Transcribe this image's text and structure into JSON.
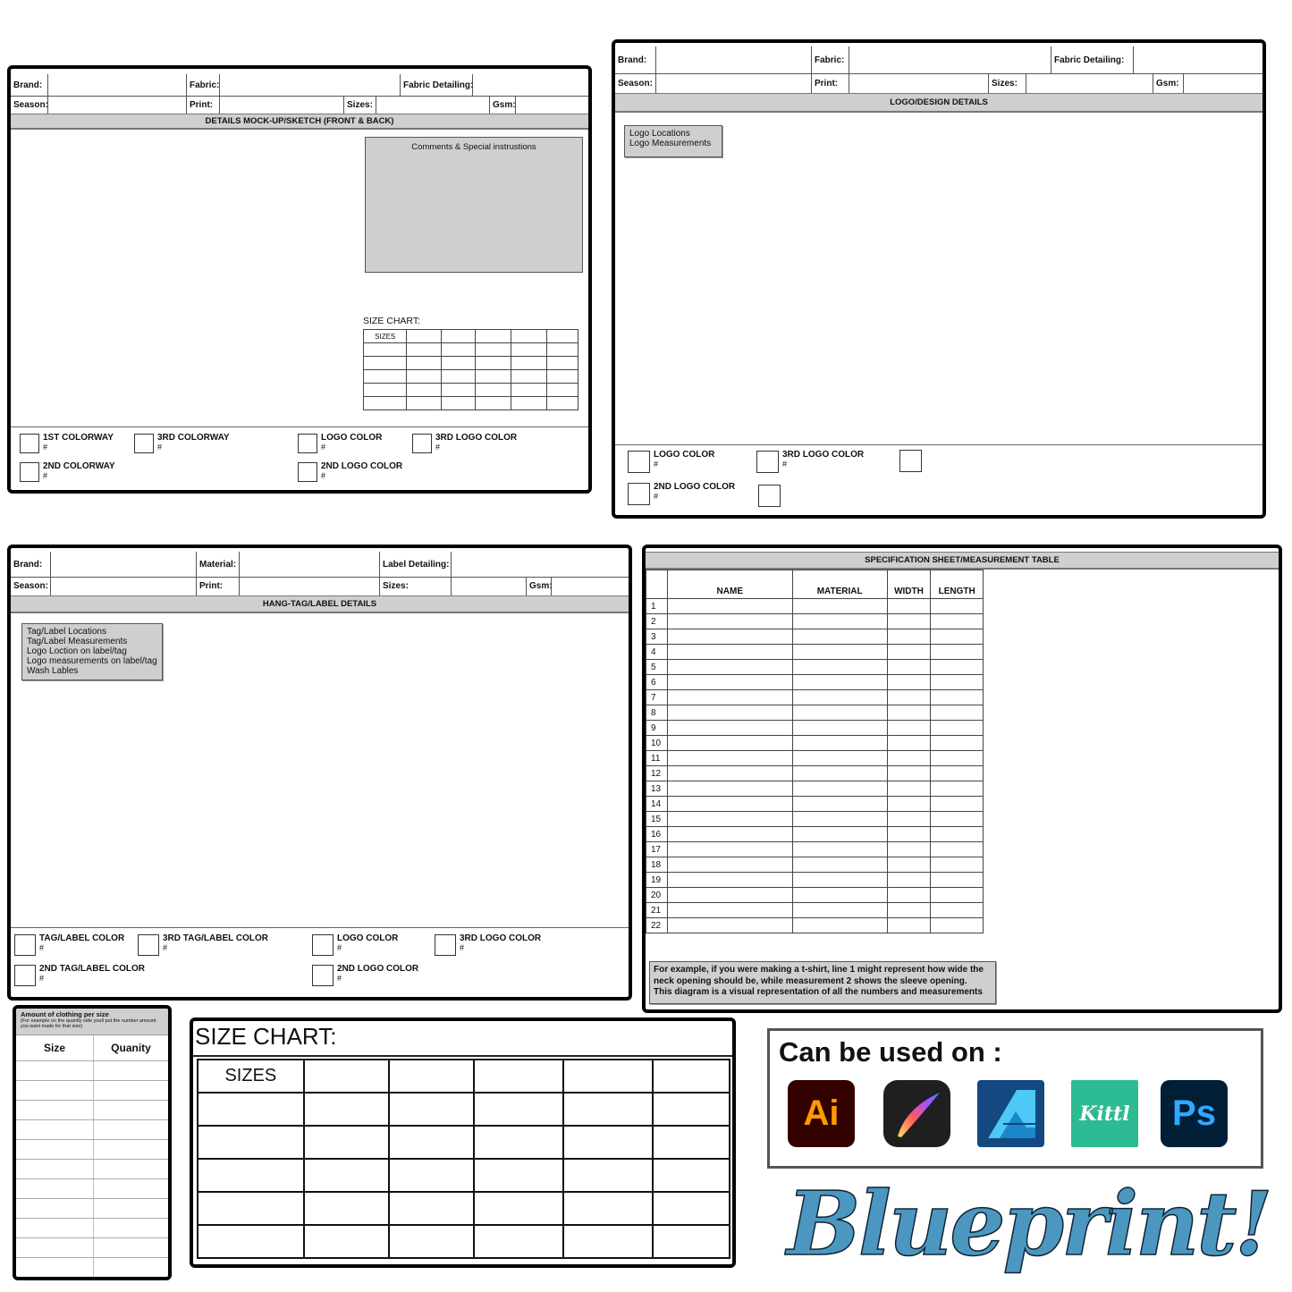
{
  "form1": {
    "row1": [
      "Brand:",
      "Fabric:",
      "Fabric Detailing:"
    ],
    "row2": [
      "Season:",
      "Print:",
      "Sizes:",
      "Gsm:"
    ],
    "band": "DETAILS MOCK-UP/SKETCH (FRONT & BACK)",
    "comments": "Comments & Special instrustions",
    "size_chart_label": "SIZE CHART:",
    "size_chart_header": "SIZES",
    "swatches": [
      {
        "label": "1ST COLORWAY",
        "hash": "#"
      },
      {
        "label": "3RD COLORWAY",
        "hash": "#"
      },
      {
        "label": "LOGO COLOR",
        "hash": "#"
      },
      {
        "label": "3RD LOGO COLOR",
        "hash": "#"
      },
      {
        "label": "2ND COLORWAY",
        "hash": "#"
      },
      {
        "label": "2ND LOGO COLOR",
        "hash": "#"
      }
    ]
  },
  "form2": {
    "row1": [
      "Brand:",
      "Fabric:",
      "Fabric Detailing:"
    ],
    "row2": [
      "Season:",
      "Print:",
      "Sizes:",
      "Gsm:"
    ],
    "band": "LOGO/DESIGN DETAILS",
    "notes": [
      "Logo Locations",
      "Logo Measurements"
    ],
    "swatches": [
      {
        "label": "LOGO COLOR",
        "hash": "#"
      },
      {
        "label": "3RD LOGO COLOR",
        "hash": "#"
      },
      {
        "label": "2ND LOGO COLOR",
        "hash": "#"
      }
    ]
  },
  "form3": {
    "row1": [
      "Brand:",
      "Material:",
      "Label Detailing:"
    ],
    "row2": [
      "Season:",
      "Print:",
      "Sizes:",
      "Gsm:"
    ],
    "band": "HANG-TAG/LABEL DETAILS",
    "notes": [
      "Tag/Label Locations",
      "Tag/Label Measurements",
      "Logo Loction on label/tag",
      "Logo measurements on label/tag",
      "Wash Lables"
    ],
    "swatches": [
      {
        "label": "TAG/LABEL COLOR",
        "hash": "#"
      },
      {
        "label": "3RD TAG/LABEL COLOR",
        "hash": "#"
      },
      {
        "label": "LOGO COLOR",
        "hash": "#"
      },
      {
        "label": "3RD LOGO COLOR",
        "hash": "#"
      },
      {
        "label": "2ND TAG/LABEL COLOR",
        "hash": "#"
      },
      {
        "label": "2ND LOGO COLOR",
        "hash": "#"
      }
    ]
  },
  "spec": {
    "title": "SPECIFICATION SHEET/MEASUREMENT TABLE",
    "columns": [
      "",
      "NAME",
      "MATERIAL",
      "WIDTH",
      "LENGTH"
    ],
    "rows": [
      "1",
      "2",
      "3",
      "4",
      "5",
      "6",
      "7",
      "8",
      "9",
      "10",
      "11",
      "12",
      "13",
      "14",
      "15",
      "16",
      "17",
      "18",
      "19",
      "20",
      "21",
      "22"
    ],
    "note": [
      "For example, if you were making a t-shirt, line 1 might represent how wide the",
      "neck opening should be, while measurement 2 shows the sleeve opening.",
      "This diagram is a visual representation of all the numbers and measurements"
    ]
  },
  "qty": {
    "title": "Amount of clothing per size",
    "subtitle": "(For example on the quanity side youll put the number amount you want made for that size)",
    "columns": [
      "Size",
      "Quanity"
    ],
    "row_count": 11
  },
  "big_chart": {
    "label": "SIZE CHART:",
    "header": "SIZES"
  },
  "apps": {
    "label": "Can be used on :",
    "items": [
      {
        "name": "illustrator",
        "text": "Ai",
        "bg": "#330000",
        "fg": "#ff9a00"
      },
      {
        "name": "procreate",
        "text": "",
        "bg": "#1f1f1f",
        "fg": "#ffffff"
      },
      {
        "name": "affinity-designer",
        "text": "",
        "bg": "#134881",
        "fg": "#4cc9f5"
      },
      {
        "name": "kittl",
        "text": "Kittl",
        "bg": "#2dbb94",
        "fg": "#ffffff"
      },
      {
        "name": "photoshop",
        "text": "Ps",
        "bg": "#001e36",
        "fg": "#31a8ff"
      }
    ]
  },
  "brand": {
    "text": "Blueprint!",
    "color": "#4b97c0"
  }
}
